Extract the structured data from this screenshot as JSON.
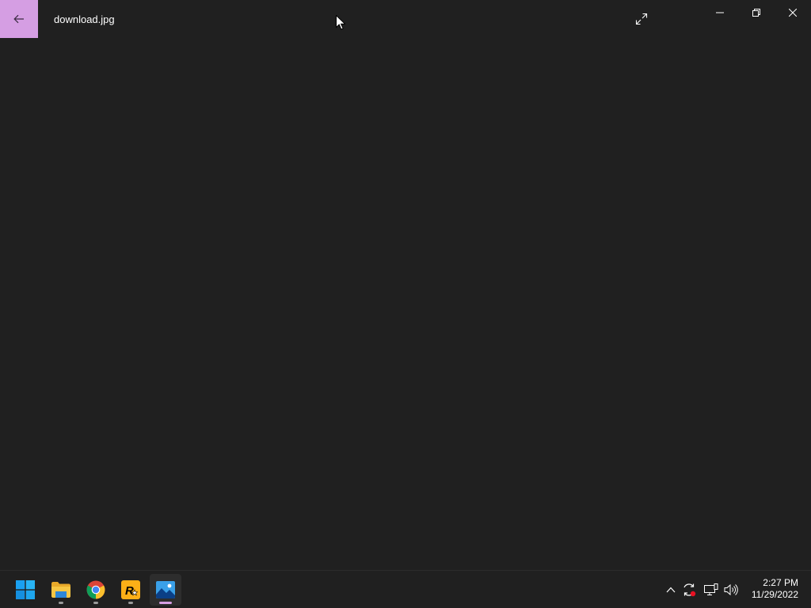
{
  "window": {
    "title": "download.jpg",
    "accent_color": "#d59ee3",
    "background_color": "#202020"
  },
  "titlebar": {
    "back_icon": "arrow-left-icon",
    "expand_icon": "expand-diagonal-icon",
    "minimize_icon": "minimize-icon",
    "maximize_icon": "restore-icon",
    "close_icon": "close-icon"
  },
  "taskbar": {
    "apps": [
      {
        "name": "Start",
        "icon": "windows-logo-icon"
      },
      {
        "name": "File Explorer",
        "icon": "folder-icon"
      },
      {
        "name": "Google Chrome",
        "icon": "chrome-icon"
      },
      {
        "name": "Rockstar Games Launcher",
        "icon": "rockstar-icon"
      },
      {
        "name": "Photos",
        "icon": "photos-icon"
      }
    ],
    "tray": {
      "icons": [
        "chevron-up-icon",
        "sync-icon",
        "network-icon",
        "volume-icon"
      ],
      "time": "2:27 PM",
      "date": "11/29/2022"
    }
  }
}
